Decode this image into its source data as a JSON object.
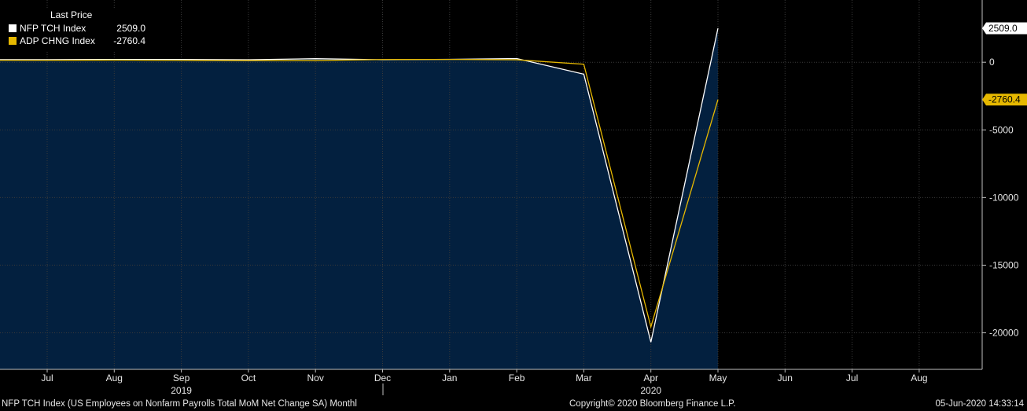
{
  "chart_data": {
    "type": "line",
    "legend": {
      "header": "Last Price",
      "entries": [
        {
          "name": "NFP TCH Index",
          "value": "2509.0",
          "color": "#ffffff"
        },
        {
          "name": "ADP CHNG Index",
          "value": "-2760.4",
          "color": "#e6b800"
        }
      ]
    },
    "x": [
      "Jul",
      "Aug",
      "Sep",
      "Oct",
      "Nov",
      "Dec",
      "Jan",
      "Feb",
      "Mar",
      "Apr",
      "May",
      "Jun",
      "Jul",
      "Aug"
    ],
    "year_labels": [
      {
        "label": "2019",
        "at": "Sep"
      },
      {
        "label": "2020",
        "at": "Apr"
      }
    ],
    "series": [
      {
        "name": "NFP TCH Index",
        "color": "#ffffff",
        "values": [
          194,
          207,
          208,
          185,
          261,
          184,
          214,
          273,
          -881,
          -20687,
          2509
        ]
      },
      {
        "name": "ADP CHNG Index",
        "color": "#e6b800",
        "values": [
          142,
          157,
          135,
          125,
          124,
          202,
          209,
          183,
          -149,
          -19557,
          -2760.4
        ]
      }
    ],
    "last_value_tags": [
      {
        "text": "2509.0",
        "value": 2509.0,
        "color": "#ffffff"
      },
      {
        "text": "-2760.4",
        "value": -2760.4,
        "color": "#e6b800"
      }
    ],
    "y_ticks": [
      0,
      -5000,
      -10000,
      -15000,
      -20000
    ],
    "y_tick_labels": [
      "0",
      "-5000",
      "-10000",
      "-15000",
      "-20000"
    ],
    "ylim": [
      -22700,
      4600
    ],
    "grid": true,
    "area_color": "#03203f"
  },
  "footer": {
    "left": "NFP TCH Index (US Employees on Nonfarm Payrolls Total MoM Net Change SA)  Monthl",
    "center": "Copyright© 2020 Bloomberg Finance L.P.",
    "right": "05-Jun-2020 14:33:14"
  }
}
